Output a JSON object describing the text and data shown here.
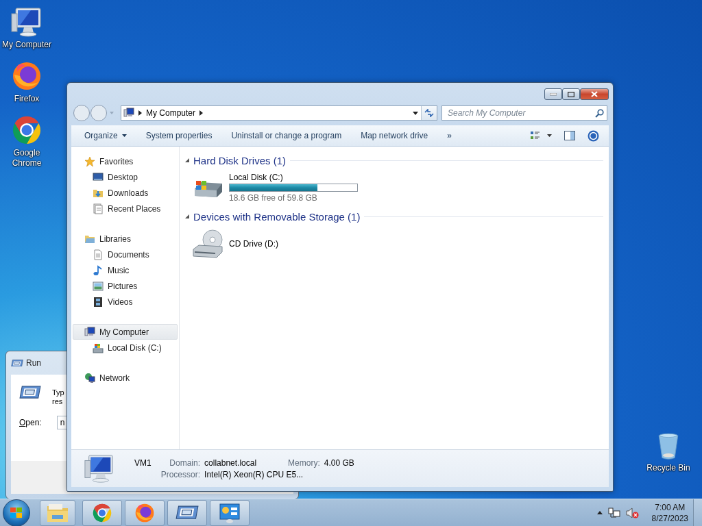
{
  "desktop_icons": [
    {
      "label": "My Computer",
      "kind": "computer"
    },
    {
      "label": "Firefox",
      "kind": "firefox"
    },
    {
      "label": "Google Chrome",
      "kind": "chrome"
    }
  ],
  "recycle_bin": {
    "label": "Recycle Bin"
  },
  "run_dialog": {
    "title": "Run",
    "prompt_lines": [
      "Typ",
      "res"
    ],
    "open_label": "Open:",
    "open_value": "n"
  },
  "explorer": {
    "address": [
      "My Computer"
    ],
    "search_placeholder": "Search My Computer",
    "toolbar": [
      {
        "label": "Organize",
        "kind": "menu"
      },
      {
        "label": "System properties",
        "kind": "command"
      },
      {
        "label": "Uninstall or change a program",
        "kind": "command"
      },
      {
        "label": "Map network drive",
        "kind": "command"
      },
      {
        "label": "»",
        "kind": "more"
      }
    ],
    "nav": [
      {
        "label": "Favorites",
        "kind": "star",
        "selected": false,
        "children": [
          {
            "label": "Desktop",
            "kind": "desktop",
            "selected": false
          },
          {
            "label": "Downloads",
            "kind": "downloads",
            "selected": false
          },
          {
            "label": "Recent Places",
            "kind": "recent",
            "selected": false
          }
        ]
      },
      {
        "label": "Libraries",
        "kind": "library",
        "selected": false,
        "children": [
          {
            "label": "Documents",
            "kind": "document",
            "selected": false
          },
          {
            "label": "Music",
            "kind": "music",
            "selected": false
          },
          {
            "label": "Pictures",
            "kind": "pictures",
            "selected": false
          },
          {
            "label": "Videos",
            "kind": "videos",
            "selected": false
          }
        ]
      },
      {
        "label": "My Computer",
        "kind": "computer",
        "selected": true,
        "children": [
          {
            "label": "Local Disk (C:)",
            "kind": "disk",
            "selected": false
          }
        ]
      },
      {
        "label": "Network",
        "kind": "network",
        "selected": false
      }
    ],
    "sections": [
      {
        "title": "Hard Disk Drives (1)",
        "items": [
          {
            "name": "Local Disk (C:)",
            "kind": "disk",
            "level": 0.69,
            "free": "18.6 GB free of 59.8 GB"
          }
        ]
      },
      {
        "title": "Devices with Removable Storage (1)",
        "items": [
          {
            "name": "CD Drive (D:)",
            "kind": "cd"
          }
        ]
      }
    ],
    "details": {
      "name": "VM1",
      "fields": [
        {
          "label": "Domain:",
          "value": "collabnet.local"
        },
        {
          "label": "Memory:",
          "value": "4.00 GB"
        },
        {
          "label": "Processor:",
          "value": "Intel(R) Xeon(R) CPU E5..."
        }
      ]
    }
  },
  "taskbar": {
    "buttons": [
      {
        "kind": "explorer"
      },
      {
        "kind": "chrome"
      },
      {
        "kind": "firefox"
      },
      {
        "kind": "run"
      },
      {
        "kind": "control"
      }
    ],
    "time": "7:00 AM",
    "date": "8/27/2023"
  }
}
